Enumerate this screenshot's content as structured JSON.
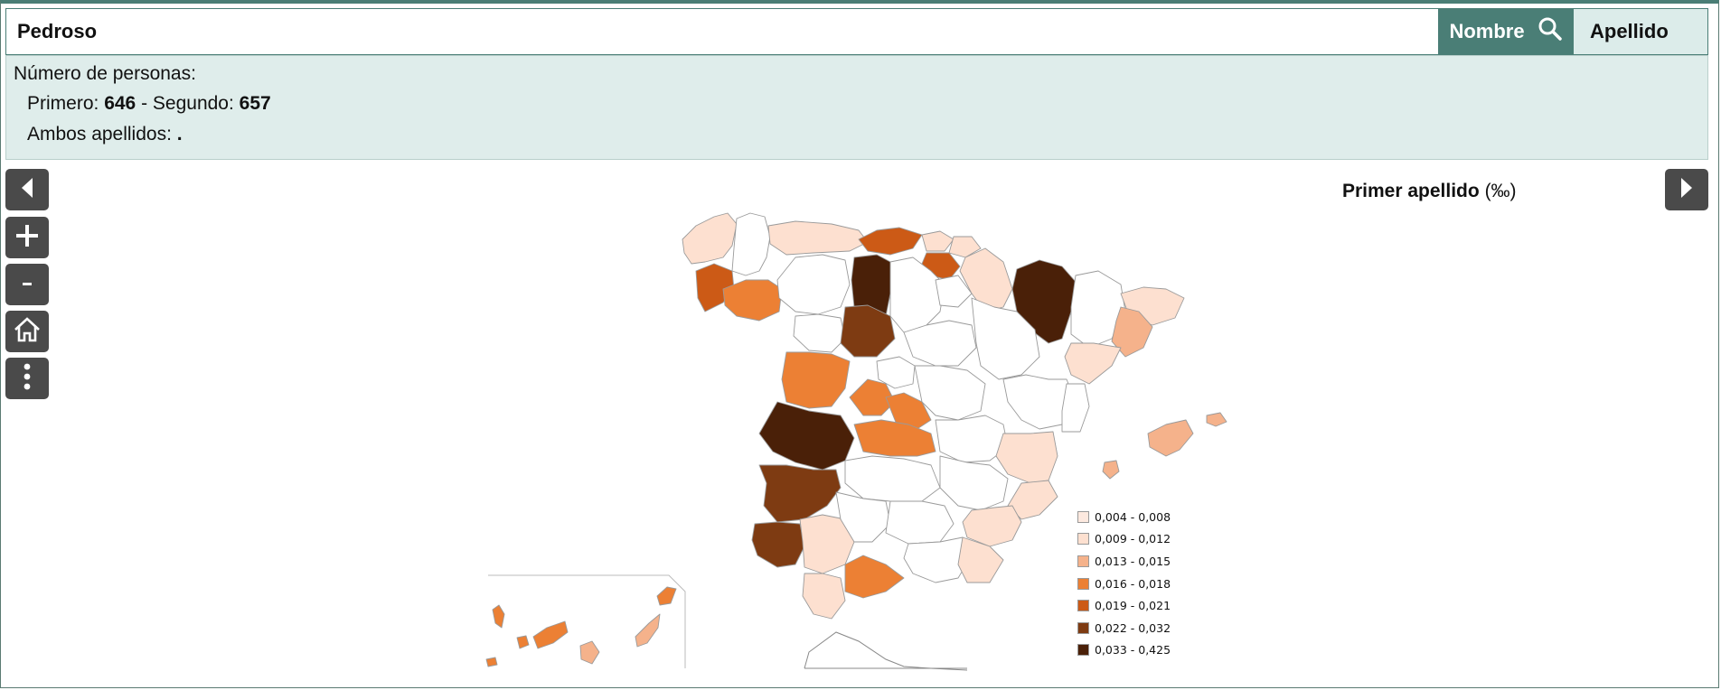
{
  "search": {
    "value": "Pedroso"
  },
  "buttons": {
    "nombre": "Nombre",
    "apellido": "Apellido"
  },
  "info": {
    "title": "Número de personas:",
    "primero_label": "Primero: ",
    "primero_value": "646",
    "sep": " - Segundo: ",
    "segundo_value": "657",
    "ambos_label": "Ambos apellidos: ",
    "ambos_value": "."
  },
  "map": {
    "title": "Primer apellido",
    "unit": "(‰)",
    "no_data_color": "#ffffff",
    "border_color": "#9a9a9a"
  },
  "legend": [
    {
      "label": "0,004 - 0,008",
      "color": "#fde9df"
    },
    {
      "label": "0,009 - 0,012",
      "color": "#fde0d0"
    },
    {
      "label": "0,013 - 0,015",
      "color": "#f5b28b"
    },
    {
      "label": "0,016 - 0,018",
      "color": "#ec8034"
    },
    {
      "label": "0,019 - 0,021",
      "color": "#cc5a16"
    },
    {
      "label": "0,022 - 0,032",
      "color": "#7e3b12"
    },
    {
      "label": "0,033 - 0,425",
      "color": "#4a2008"
    }
  ],
  "controls": [
    "prev-arrow-icon",
    "zoom-in-icon",
    "zoom-out-icon",
    "home-icon",
    "more-vertical-icon",
    "next-arrow-icon"
  ]
}
